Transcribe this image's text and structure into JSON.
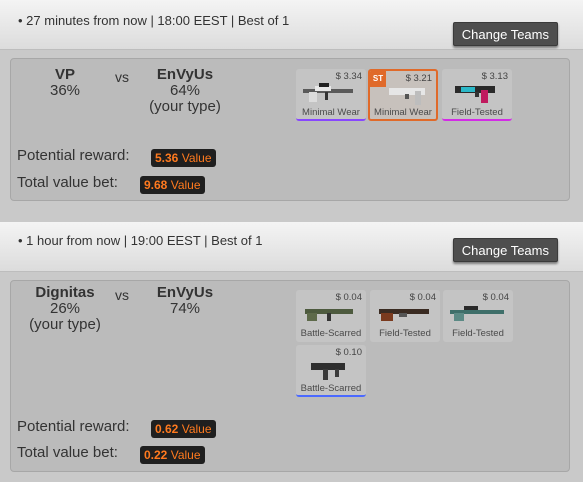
{
  "colors": {
    "accent": "#e06a2a",
    "badge_text": "#ff7a1f",
    "badge_bg": "#1f1f1f",
    "covert": "#a335ee",
    "classified": "#d32ce6",
    "restricted": "#8847ff",
    "milspec": "#4b69ff",
    "industrial": "#5e98d9"
  },
  "matches": [
    {
      "info": "• 27 minutes from now | 18:00 EEST | Best of 1",
      "change_label": "Change Teams",
      "team1": {
        "name": "VP",
        "pct": "36%",
        "note": ""
      },
      "vs": "vs",
      "team2": {
        "name": "EnVyUs",
        "pct": "64%",
        "note": "(your type)"
      },
      "items": [
        {
          "price": "$ 3.34",
          "wear": "Minimal Wear",
          "icon": "awp-icon",
          "stattrak": ""
        },
        {
          "price": "$ 3.21",
          "wear": "Minimal Wear",
          "icon": "deagle-icon",
          "stattrak": "ST"
        },
        {
          "price": "$ 3.13",
          "wear": "Field-Tested",
          "icon": "usp-icon",
          "stattrak": ""
        }
      ],
      "potential_label": "Potential reward:",
      "potential_value": "5.36",
      "total_label": "Total value bet:",
      "total_value": "9.68",
      "value_unit": "Value"
    },
    {
      "info": "• 1 hour from now | 19:00 EEST | Best of 1",
      "change_label": "Change Teams",
      "team1": {
        "name": "Dignitas",
        "pct": "26%",
        "note": "(your type)"
      },
      "vs": "vs",
      "team2": {
        "name": "EnVyUs",
        "pct": "74%",
        "note": ""
      },
      "items": [
        {
          "price": "$ 0.04",
          "wear": "Battle-Scarred",
          "icon": "rifle-icon",
          "stattrak": ""
        },
        {
          "price": "$ 0.04",
          "wear": "Field-Tested",
          "icon": "shotgun-icon",
          "stattrak": ""
        },
        {
          "price": "$ 0.04",
          "wear": "Field-Tested",
          "icon": "sniper-icon",
          "stattrak": ""
        },
        {
          "price": "$ 0.10",
          "wear": "Battle-Scarred",
          "icon": "smg-icon",
          "stattrak": ""
        }
      ],
      "potential_label": "Potential reward:",
      "potential_value": "0.62",
      "total_label": "Total value bet:",
      "total_value": "0.22",
      "value_unit": "Value"
    }
  ]
}
